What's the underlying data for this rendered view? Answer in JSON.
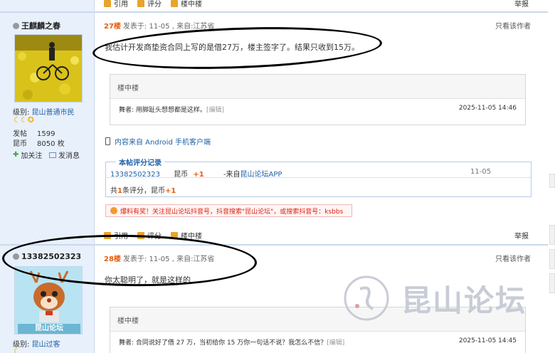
{
  "actions": {
    "cite": "引用",
    "rate": "评分",
    "floor_in_floor": "楼中楼",
    "report": "举报"
  },
  "post27": {
    "username": "王麒麟之春",
    "level_label": "级别:",
    "level": "昆山普通市民",
    "stats": [
      {
        "label": "发帖",
        "value": "1599"
      },
      {
        "label": "昆币",
        "value": "8050 枚"
      }
    ],
    "follow": "加关注",
    "message": "发消息",
    "floor": "27楼",
    "meta": "发表于: 11-05 , 来自:江苏省",
    "only_author": "只看该作者",
    "content": "我估计开发商垫资合同上写的是借27万，楼主签字了。结果只收到15万。",
    "quote": {
      "header": "楼中楼",
      "author": "舞者:",
      "text": "用脚趾头想想都是这样。",
      "edit": "[编辑]",
      "time": "2025-11-05 14:46"
    },
    "mobile_source": "内容来自 Android 手机客户端",
    "rating": {
      "title": "本帖评分记录",
      "user": "13382502323",
      "currency": "昆币",
      "amount": "+1",
      "source_prefix": "-来自",
      "source_app": "昆山论坛APP",
      "date": "11-05",
      "summary_prefix": "共",
      "summary_count": "1",
      "summary_mid": "条评分，昆币",
      "summary_amount": "+1"
    },
    "ad": "爆料有奖！关注昆山论坛抖音号，抖音搜索\"昆山论坛\"，或搜索抖音号：ksbbs"
  },
  "post28": {
    "username": "13382502323",
    "avatar_caption": "昆山论坛",
    "level_label": "级别:",
    "level": "昆山过客",
    "floor": "28楼",
    "meta": "发表于: 11-05 , 来自:江苏省",
    "only_author": "只看该作者",
    "content": "你太聪明了，就是这样的",
    "quote": {
      "header": "楼中楼",
      "author": "舞者:",
      "text": "合同说好了借 27 万，当初给你 15 万你一句话不说？我怎么不信？",
      "edit": "[编辑]",
      "time": "2025-11-05 14:45"
    }
  },
  "watermark": "昆山论坛",
  "colors": {
    "accent": "#2163a8",
    "floor": "#e85c0d",
    "left_bg": "#e8f0fb",
    "ad_red": "#d9230f"
  }
}
